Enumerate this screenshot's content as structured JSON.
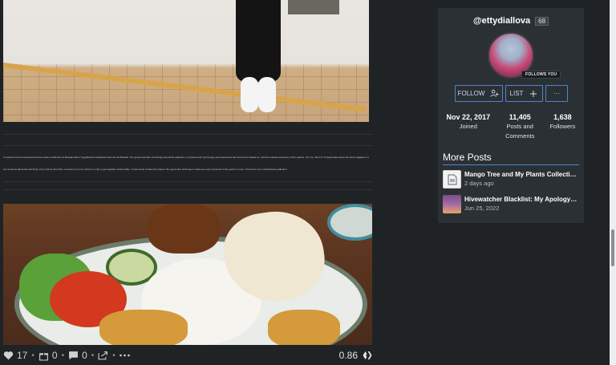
{
  "post": {
    "paragraph1": "In another level of cutesyness there is also a collection of fairytale about Yogyakarta's bookstores built out the Booklet. The group and their recordings plus all the galleries, my friends and I got hungry and selected at the Food Court beside us, with the snacks and plenty of the options. For me, this is it! I'd appreciate about the fresh veggies to a satisfied lunch! No day of a wonderful gathering with you.",
    "paragraph2": "Let me know about the last thing of my visit for all of this, a memory for us to share in a trip to get together at this coffee. It was lovely to have the place in the good vibe and hope to share as many moments in the years to come. I'd love for us to visit all these galleries!",
    "votes": "17",
    "gifts": "0",
    "comments": "0",
    "payout": "0.86"
  },
  "profile": {
    "username": "@ettydiallova",
    "reputation": "68",
    "follows_you": "FOLLOWS YOU",
    "follow_label": "FOLLOW",
    "list_label": "LIST",
    "more_label": "···",
    "stats": [
      {
        "value": "Nov 22, 2017",
        "label": "Joined"
      },
      {
        "value": "11,405",
        "label": "Posts and Comments"
      },
      {
        "value": "1,638",
        "label": "Followers"
      }
    ]
  },
  "more_posts": {
    "heading": "More Posts",
    "items": [
      {
        "title": "Mango Tree and My Plants Collection i...",
        "date": "2 days ago"
      },
      {
        "title": "Hivewatcher Blacklist: My Apology to ...",
        "date": "Jun 25, 2022"
      }
    ]
  },
  "colors": {
    "background": "#1f2326",
    "card": "#2b3035",
    "accent": "#4e86c6"
  },
  "icons": [
    "heart-icon",
    "gift-icon",
    "comment-icon",
    "reblog-icon",
    "more-icon",
    "hive-icon",
    "add-user-icon",
    "plus-icon",
    "document-icon"
  ]
}
